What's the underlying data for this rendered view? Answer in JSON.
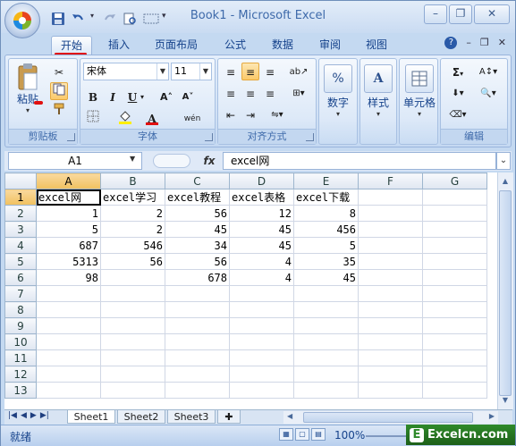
{
  "window": {
    "title": "Book1 - Microsoft Excel",
    "minimize": "–",
    "restore": "❐",
    "close": "✕"
  },
  "ribbon_tabs": [
    "开始",
    "插入",
    "页面布局",
    "公式",
    "数据",
    "审阅",
    "视图"
  ],
  "ribbon_tabs_active": "开始",
  "ribbon": {
    "clipboard": {
      "paste": "粘贴",
      "label": "剪贴板"
    },
    "font": {
      "name": "宋体",
      "size": "11",
      "bold": "B",
      "italic": "I",
      "underline": "U",
      "grow": "A˄",
      "shrink": "A˅",
      "font_color": "A",
      "wen": "wén",
      "label": "字体"
    },
    "alignment": {
      "label": "对齐方式"
    },
    "number": {
      "button": "数字",
      "symbol": "%"
    },
    "styles": {
      "button": "样式"
    },
    "cells": {
      "button": "单元格"
    },
    "editing": {
      "label": "编辑",
      "sum": "Σ"
    }
  },
  "formula_bar": {
    "name_box": "A1",
    "fx": "fx",
    "content": "excel网"
  },
  "sheet": {
    "columns": [
      "A",
      "B",
      "C",
      "D",
      "E",
      "F",
      "G"
    ],
    "row_numbers": [
      "1",
      "2",
      "3",
      "4",
      "5",
      "6",
      "7",
      "8",
      "9",
      "10",
      "11",
      "12",
      "13"
    ],
    "rows": [
      [
        "excel网",
        "excel学习",
        "excel教程",
        "excel表格",
        "excel下载",
        "",
        ""
      ],
      [
        "1",
        "2",
        "56",
        "12",
        "8",
        "",
        ""
      ],
      [
        "5",
        "2",
        "45",
        "45",
        "456",
        "",
        ""
      ],
      [
        "687",
        "546",
        "34",
        "45",
        "5",
        "",
        ""
      ],
      [
        "5313",
        "56",
        "56",
        "4",
        "35",
        "",
        ""
      ],
      [
        "98",
        "",
        "678",
        "4",
        "45",
        "",
        ""
      ],
      [
        "",
        "",
        "",
        "",
        "",
        "",
        ""
      ],
      [
        "",
        "",
        "",
        "",
        "",
        "",
        ""
      ],
      [
        "",
        "",
        "",
        "",
        "",
        "",
        ""
      ],
      [
        "",
        "",
        "",
        "",
        "",
        "",
        ""
      ],
      [
        "",
        "",
        "",
        "",
        "",
        "",
        ""
      ],
      [
        "",
        "",
        "",
        "",
        "",
        "",
        ""
      ],
      [
        "",
        "",
        "",
        "",
        "",
        "",
        ""
      ]
    ],
    "active_cell": "A1"
  },
  "sheet_tabs": [
    "Sheet1",
    "Sheet2",
    "Sheet3"
  ],
  "sheet_tabs_active": "Sheet1",
  "status": {
    "ready": "就绪",
    "zoom": "100%"
  },
  "watermark": {
    "letter": "E",
    "text": "Excelcn.com"
  }
}
